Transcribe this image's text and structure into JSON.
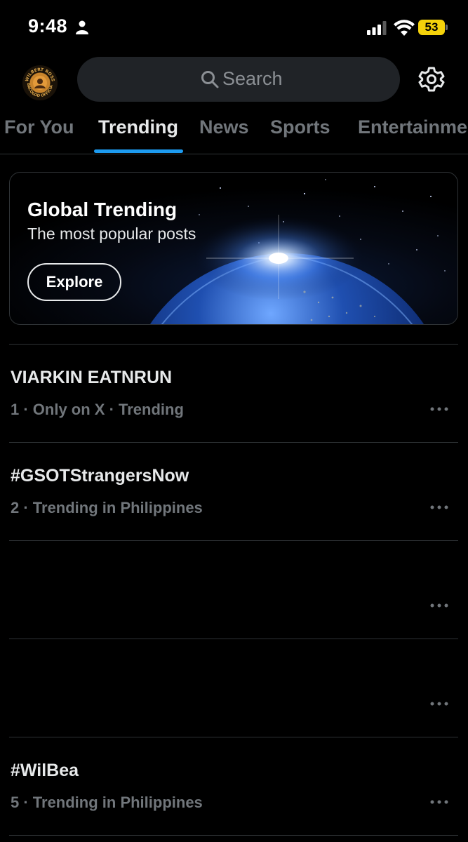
{
  "status_bar": {
    "time": "9:48",
    "battery": "53"
  },
  "header": {
    "avatar_text": [
      "WILBERT ROSS",
      "BACOLOD OFFICIAL"
    ],
    "search_placeholder": "Search"
  },
  "tabs": [
    {
      "label": "For You",
      "active": false
    },
    {
      "label": "Trending",
      "active": true
    },
    {
      "label": "News",
      "active": false
    },
    {
      "label": "Sports",
      "active": false
    },
    {
      "label": "Entertainme",
      "active": false
    }
  ],
  "hero": {
    "title": "Global Trending",
    "subtitle": "The most popular posts",
    "button_label": "Explore"
  },
  "trends": [
    {
      "name": "VIARKIN EATNRUN",
      "meta": "1 · Only on X · Trending"
    },
    {
      "name": "#GSOTStrangersNow",
      "meta": "2 · Trending in Philippines"
    },
    {
      "name": "",
      "meta": ""
    },
    {
      "name": "",
      "meta": ""
    },
    {
      "name": "#WilBea",
      "meta": "5 · Trending in Philippines"
    }
  ],
  "colors": {
    "accent": "#1d9bf0",
    "background": "#000000",
    "muted_text": "#71767b",
    "battery": "#f5d20b"
  },
  "icons": [
    "person-icon",
    "signal-icon",
    "wifi-icon",
    "search-icon",
    "gear-icon",
    "more-icon"
  ]
}
